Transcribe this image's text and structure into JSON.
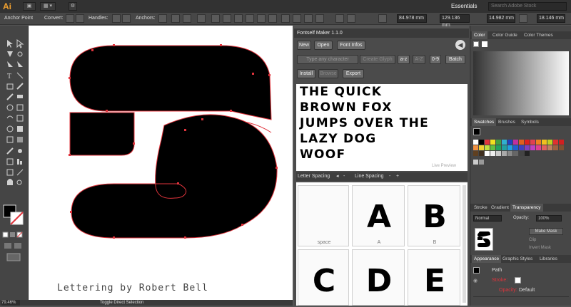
{
  "app": {
    "logo": "Ai",
    "workspace": "Essentials",
    "search_placeholder": "Search Adobe Stock"
  },
  "control_bar": {
    "mode": "Anchor Point",
    "convert_label": "Convert:",
    "handles_label": "Handles:",
    "anchors_label": "Anchors:",
    "x_value": "84.978 mm",
    "y_value": "129.136 mm",
    "w_value": "14.982 mm",
    "h_value": "18.146 mm"
  },
  "artboard": {
    "credit": "Lettering by Robert Bell"
  },
  "status": {
    "zoom": "79.46%",
    "text": "Toggle Direct Selection"
  },
  "fontself": {
    "title": "Fontself Maker 1.1.0",
    "buttons": {
      "new": "New",
      "open": "Open",
      "font_infos": "Font Infos",
      "install": "Install",
      "browse": "Browse",
      "export": "Export",
      "batch": "Batch"
    },
    "type_placeholder": "Type any character",
    "create_glyph": "Create Glyph",
    "sort_az": "a-z",
    "sort_AZ": "A-Z",
    "sort_09": "0-9",
    "preview_lines": [
      "THE QUICK",
      "BROWN FOX",
      "JUMPS OVER THE",
      "LAZY DOG",
      "WOOF"
    ],
    "live_preview": "Live Preview",
    "letter_spacing": "Letter Spacing",
    "line_spacing": "Line Spacing",
    "glyphs": [
      {
        "char": "",
        "label": "space"
      },
      {
        "char": "A",
        "label": "A"
      },
      {
        "char": "B",
        "label": "B"
      },
      {
        "char": "C",
        "label": ""
      },
      {
        "char": "D",
        "label": ""
      },
      {
        "char": "E",
        "label": ""
      }
    ]
  },
  "panels": {
    "color_tabs": [
      "Color",
      "Color Guide",
      "Color Themes"
    ],
    "swatch_tabs": [
      "Swatches",
      "Brushes",
      "Symbols"
    ],
    "stroke_tabs": [
      "Stroke",
      "Gradient",
      "Transparency"
    ],
    "blend_mode": "Normal",
    "opacity_label": "Opacity:",
    "opacity_value": "100%",
    "make_mask": "Make Mask",
    "clip": "Clip",
    "invert_mask": "Invert Mask",
    "appearance_tabs": [
      "Appearance",
      "Graphic Styles",
      "Libraries"
    ],
    "appearance_title": "Path",
    "appearance_stroke": "Stroke:",
    "appearance_opacity": "Opacity:",
    "appearance_opacity_value": "Default"
  },
  "colors": {
    "accent": "#f0a030",
    "path_outline": "#e0343c"
  }
}
